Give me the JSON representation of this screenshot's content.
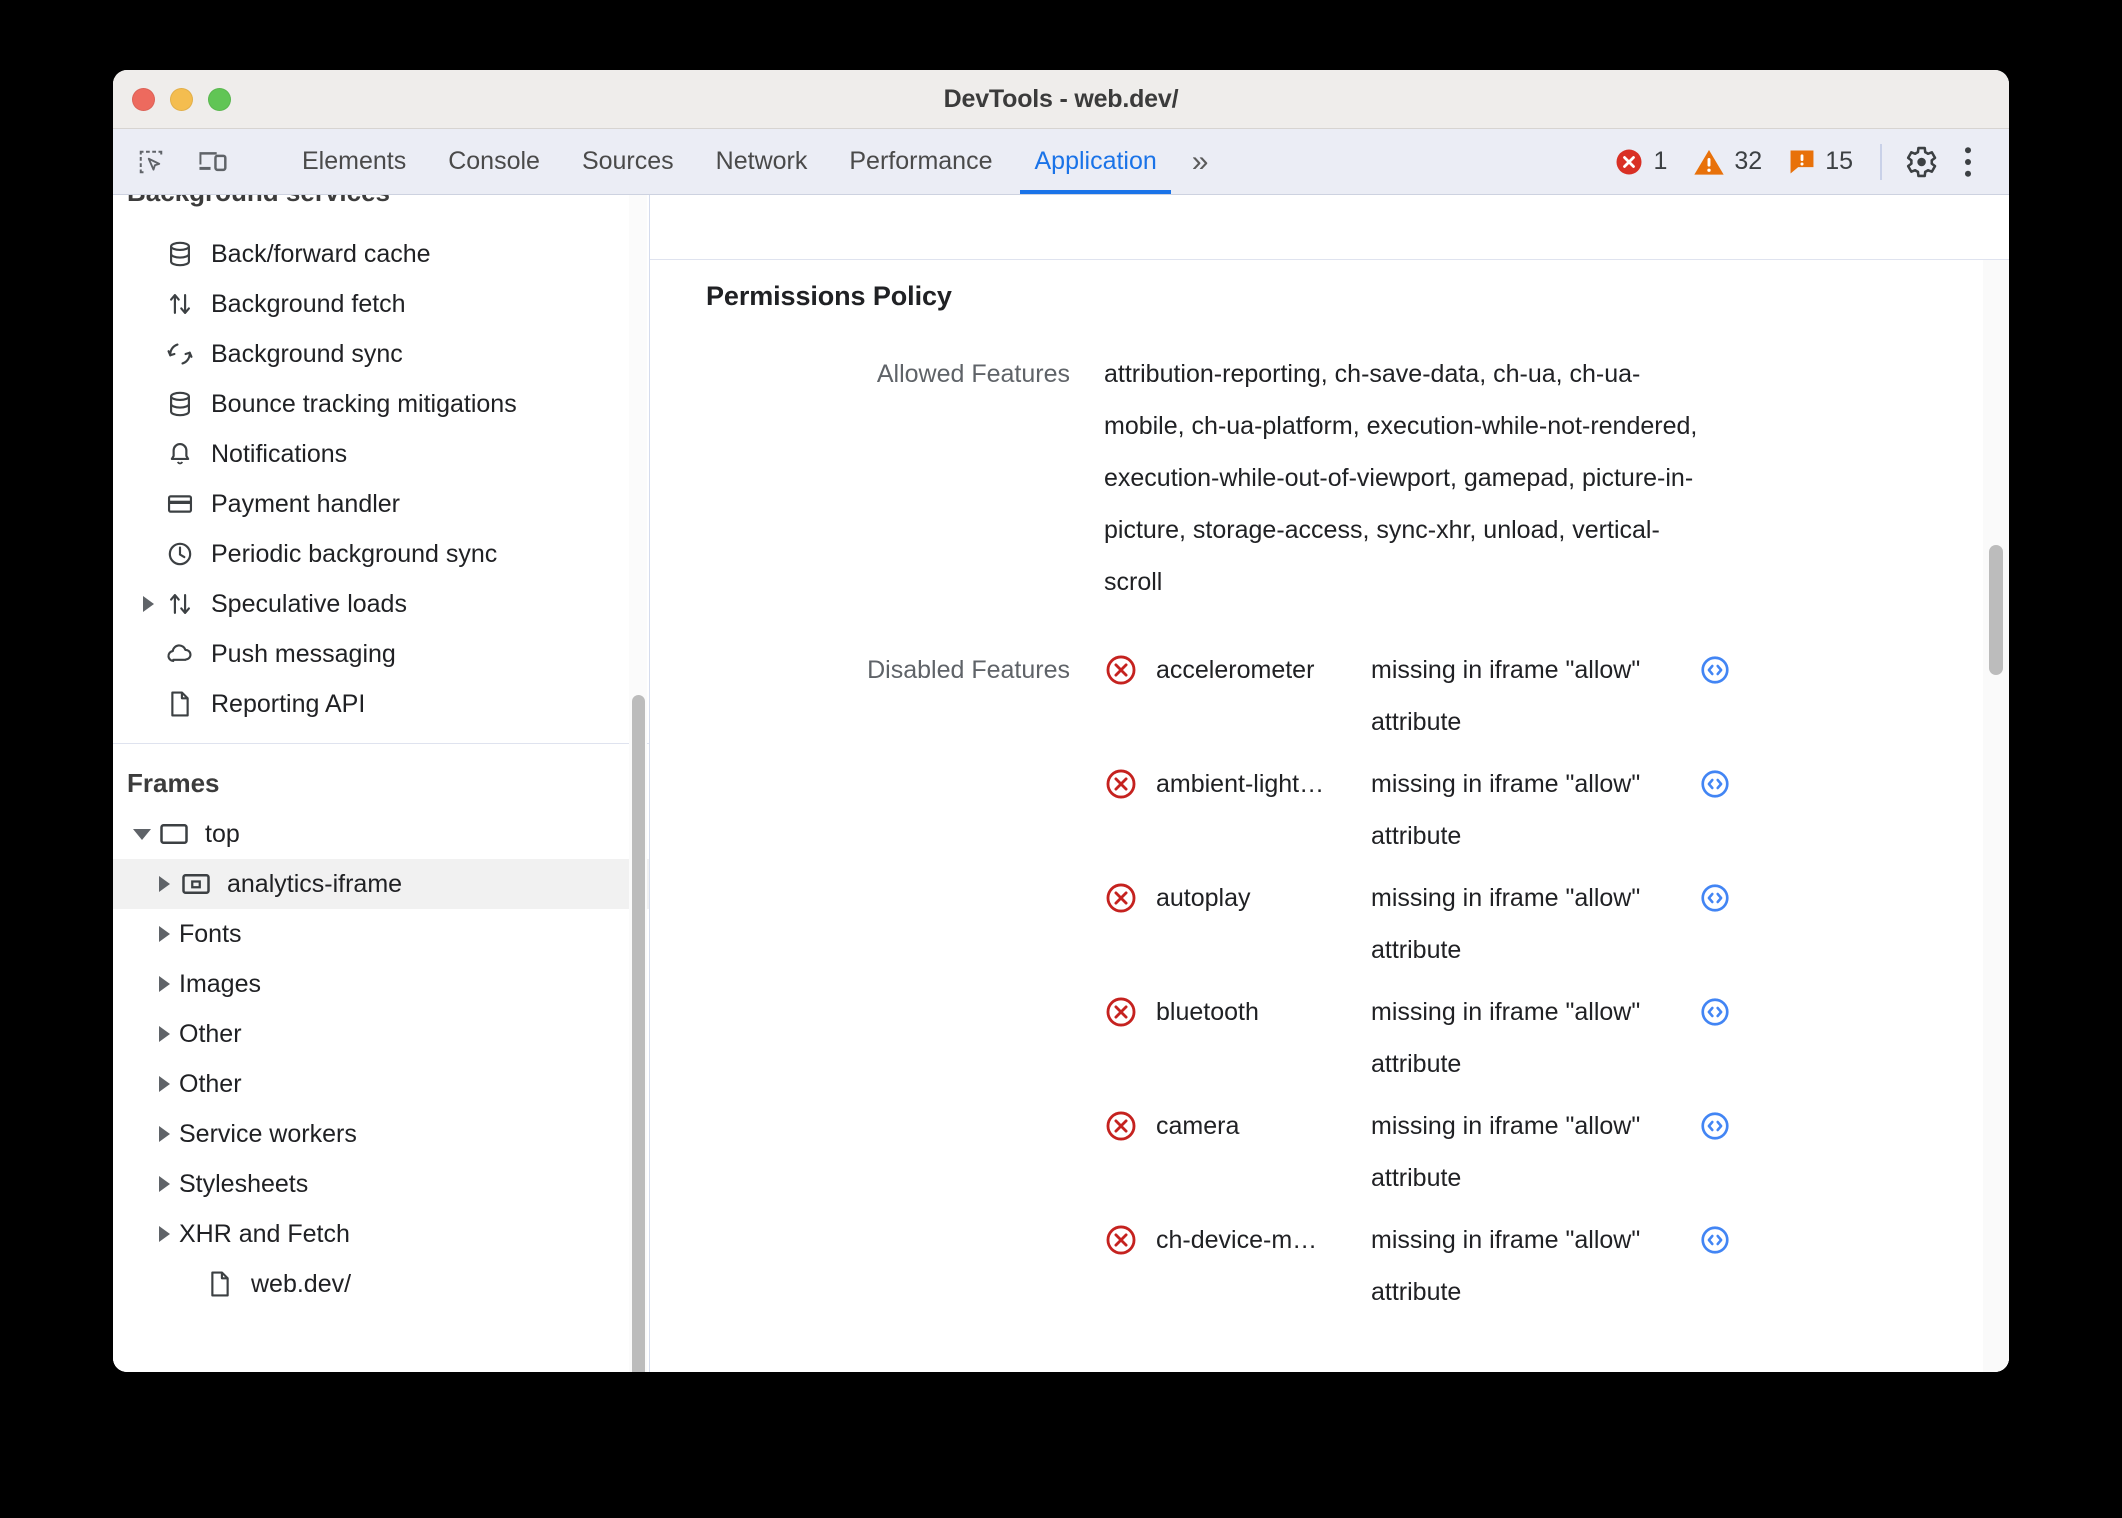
{
  "window": {
    "title": "DevTools - web.dev/",
    "traffic_lights": [
      "close-red",
      "minimize-yellow",
      "zoom-green"
    ]
  },
  "toolbar": {
    "inspect_icon": "inspect-element-icon",
    "device_icon": "device-toolbar-icon",
    "tabs": [
      {
        "label": "Elements",
        "active": false
      },
      {
        "label": "Console",
        "active": false
      },
      {
        "label": "Sources",
        "active": false
      },
      {
        "label": "Network",
        "active": false
      },
      {
        "label": "Performance",
        "active": false
      },
      {
        "label": "Application",
        "active": true
      }
    ],
    "more_tabs_label": "»",
    "counters": {
      "errors": "1",
      "warnings": "32",
      "issues": "15"
    },
    "settings_icon": "gear-icon",
    "menu_icon": "kebab-menu-icon",
    "accent_color": "#1a73e8",
    "error_color": "#d93025",
    "warning_color": "#e8710a"
  },
  "sidebar": {
    "background_services": {
      "title": "Background services",
      "items": [
        {
          "label": "Back/forward cache",
          "icon": "database-icon",
          "expandable": false
        },
        {
          "label": "Background fetch",
          "icon": "sync-arrows-icon",
          "expandable": false
        },
        {
          "label": "Background sync",
          "icon": "circular-arrows-icon",
          "expandable": false
        },
        {
          "label": "Bounce tracking mitigations",
          "icon": "database-icon",
          "expandable": false
        },
        {
          "label": "Notifications",
          "icon": "bell-icon",
          "expandable": false
        },
        {
          "label": "Payment handler",
          "icon": "credit-card-icon",
          "expandable": false
        },
        {
          "label": "Periodic background sync",
          "icon": "clock-icon",
          "expandable": false
        },
        {
          "label": "Speculative loads",
          "icon": "sync-arrows-icon",
          "expandable": true
        },
        {
          "label": "Push messaging",
          "icon": "cloud-icon",
          "expandable": false
        },
        {
          "label": "Reporting API",
          "icon": "document-icon",
          "expandable": false
        }
      ]
    },
    "frames": {
      "title": "Frames",
      "items": [
        {
          "label": "top",
          "icon": "frame-icon",
          "level": 0,
          "expandable": true,
          "expanded": true,
          "selected": false
        },
        {
          "label": "analytics-iframe",
          "icon": "iframe-icon",
          "level": 1,
          "expandable": true,
          "expanded": false,
          "selected": true
        },
        {
          "label": "Fonts",
          "icon": "",
          "level": 1,
          "expandable": true,
          "expanded": false,
          "selected": false
        },
        {
          "label": "Images",
          "icon": "",
          "level": 1,
          "expandable": true,
          "expanded": false,
          "selected": false
        },
        {
          "label": "Other",
          "icon": "",
          "level": 1,
          "expandable": true,
          "expanded": false,
          "selected": false
        },
        {
          "label": "Other",
          "icon": "",
          "level": 1,
          "expandable": true,
          "expanded": false,
          "selected": false
        },
        {
          "label": "Service workers",
          "icon": "",
          "level": 1,
          "expandable": true,
          "expanded": false,
          "selected": false
        },
        {
          "label": "Stylesheets",
          "icon": "",
          "level": 1,
          "expandable": true,
          "expanded": false,
          "selected": false
        },
        {
          "label": "XHR and Fetch",
          "icon": "",
          "level": 1,
          "expandable": true,
          "expanded": false,
          "selected": false
        },
        {
          "label": "web.dev/",
          "icon": "document-icon",
          "level": 1,
          "expandable": false,
          "expanded": false,
          "selected": false
        }
      ]
    }
  },
  "main": {
    "section_title": "Permissions Policy",
    "allowed": {
      "key": "Allowed Features",
      "value": "attribution-reporting, ch-save-data, ch-ua, ch-ua-mobile, ch-ua-platform, execution-while-not-rendered, execution-while-out-of-viewport, gamepad, picture-in-picture, storage-access, sync-xhr, unload, vertical-scroll"
    },
    "disabled": {
      "key": "Disabled Features",
      "rows": [
        {
          "name": "accelerometer",
          "reason": "missing in iframe \"allow\" attribute",
          "icon": "error-circle-x-icon",
          "link_icon": "code-circle-icon"
        },
        {
          "name": "ambient-light…",
          "reason": "missing in iframe \"allow\" attribute",
          "icon": "error-circle-x-icon",
          "link_icon": "code-circle-icon"
        },
        {
          "name": "autoplay",
          "reason": "missing in iframe \"allow\" attribute",
          "icon": "error-circle-x-icon",
          "link_icon": "code-circle-icon"
        },
        {
          "name": "bluetooth",
          "reason": "missing in iframe \"allow\" attribute",
          "icon": "error-circle-x-icon",
          "link_icon": "code-circle-icon"
        },
        {
          "name": "camera",
          "reason": "missing in iframe \"allow\" attribute",
          "icon": "error-circle-x-icon",
          "link_icon": "code-circle-icon"
        },
        {
          "name": "ch-device-m…",
          "reason": "missing in iframe \"allow\" attribute",
          "icon": "error-circle-x-icon",
          "link_icon": "code-circle-icon"
        }
      ]
    }
  }
}
